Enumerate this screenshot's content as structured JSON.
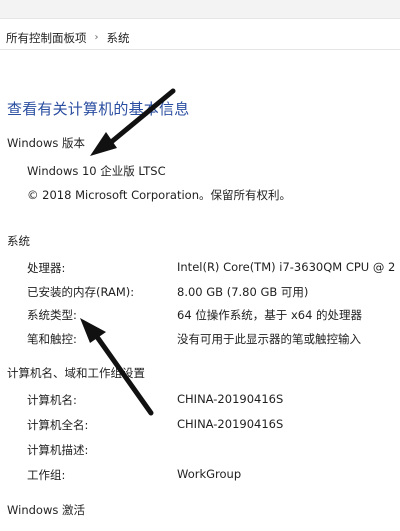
{
  "breadcrumb": {
    "items": [
      "所有控制面板项",
      "系统"
    ],
    "separator": "›"
  },
  "title": "查看有关计算机的基本信息",
  "windows_edition": {
    "heading": "Windows 版本",
    "edition": "Windows 10 企业版 LTSC",
    "copyright": "© 2018 Microsoft Corporation。保留所有权利。"
  },
  "system": {
    "heading": "系统",
    "rows": [
      {
        "label": "处理器:",
        "value": "Intel(R) Core(TM) i7-3630QM CPU @ 2"
      },
      {
        "label": "已安装的内存(RAM):",
        "value": "8.00 GB (7.80 GB 可用)"
      },
      {
        "label": "系统类型:",
        "value": "64 位操作系统，基于 x64 的处理器"
      },
      {
        "label": "笔和触控:",
        "value": "没有可用于此显示器的笔或触控输入"
      }
    ]
  },
  "computer_name": {
    "heading": "计算机名、域和工作组设置",
    "rows": [
      {
        "label": "计算机名:",
        "value": "CHINA-20190416S"
      },
      {
        "label": "计算机全名:",
        "value": "CHINA-20190416S"
      },
      {
        "label": "计算机描述:",
        "value": ""
      },
      {
        "label": "工作组:",
        "value": "WorkGroup"
      }
    ]
  },
  "activation": {
    "heading": "Windows 激活"
  },
  "annotation_color": "#111111"
}
